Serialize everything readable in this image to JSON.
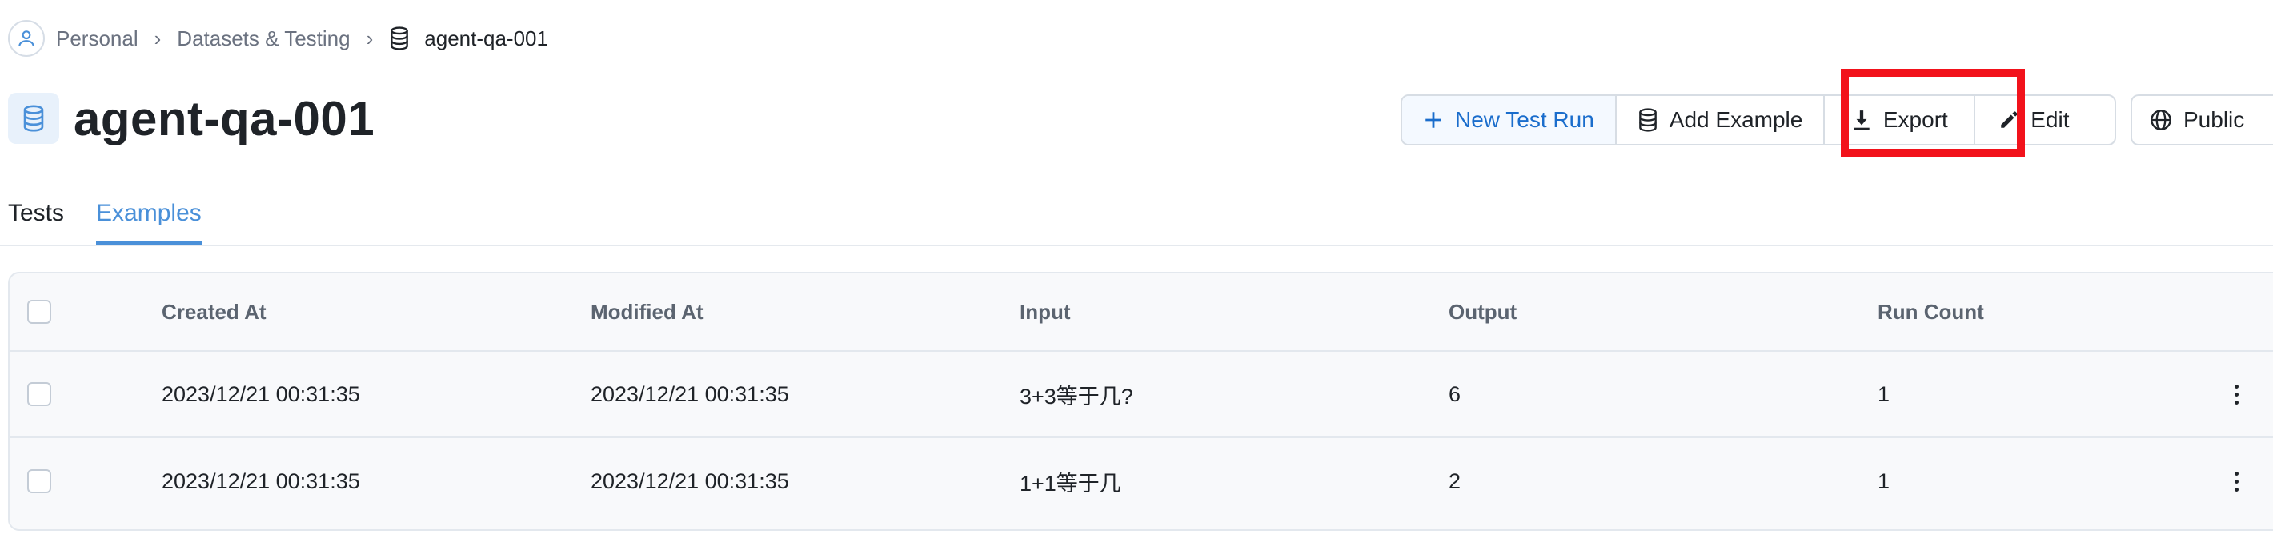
{
  "breadcrumb": {
    "items": [
      "Personal",
      "Datasets & Testing"
    ],
    "current": "agent-qa-001"
  },
  "page": {
    "title": "agent-qa-001"
  },
  "toolbar": {
    "new_test_run": "New Test Run",
    "add_example": "Add Example",
    "export": "Export",
    "edit": "Edit",
    "public": "Public"
  },
  "tabs": [
    {
      "label": "Tests",
      "active": false
    },
    {
      "label": "Examples",
      "active": true
    }
  ],
  "table": {
    "columns": [
      "Created At",
      "Modified At",
      "Input",
      "Output",
      "Run Count"
    ],
    "rows": [
      {
        "created": "2023/12/21 00:31:35",
        "modified": "2023/12/21 00:31:35",
        "input": "3+3等于几?",
        "output": "6",
        "runs": "1"
      },
      {
        "created": "2023/12/21 00:31:35",
        "modified": "2023/12/21 00:31:35",
        "input": "1+1等于几",
        "output": "2",
        "runs": "1"
      }
    ]
  },
  "colors": {
    "accent": "#4a90d9",
    "primary_text": "#1a6dcc",
    "highlight": "#f2121b"
  },
  "icons": [
    "user-icon",
    "chevron-right-icon",
    "database-icon",
    "plus-icon",
    "download-icon",
    "pencil-icon",
    "globe-icon",
    "more-vertical-icon"
  ]
}
